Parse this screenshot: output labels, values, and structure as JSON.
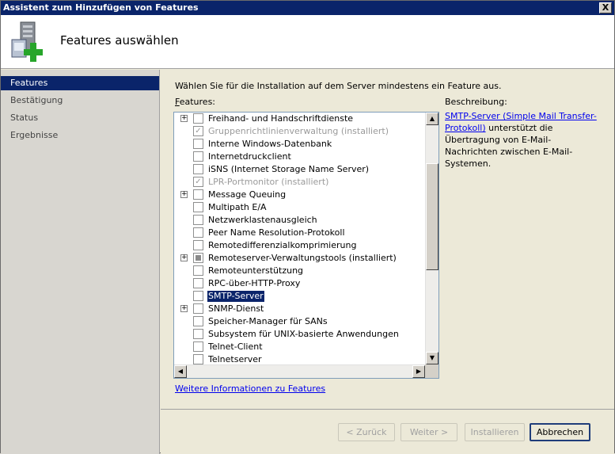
{
  "window": {
    "title": "Assistent zum Hinzufügen von Features",
    "close_label": "X"
  },
  "header": {
    "title": "Features auswählen",
    "icon": "server-add-icon"
  },
  "sidebar": {
    "items": [
      {
        "label": "Features",
        "active": true
      },
      {
        "label": "Bestätigung",
        "active": false
      },
      {
        "label": "Status",
        "active": false
      },
      {
        "label": "Ergebnisse",
        "active": false
      }
    ]
  },
  "main": {
    "intro": "Wählen Sie für die Installation auf dem Server mindestens ein Feature aus.",
    "features_label_prefix": "F",
    "features_label_rest": "eatures:",
    "description_label": "Beschreibung:",
    "description_link": "SMTP-Server (Simple Mail Transfer-Protokoll)",
    "description_text": " unterstützt die Übertragung von E-Mail-Nachrichten zwischen E-Mail-Systemen.",
    "more_info_link": "Weitere Informationen zu Features"
  },
  "features": [
    {
      "label": "Freihand- und Handschriftdienste",
      "expandable": true,
      "state": "unchecked",
      "dim": false,
      "selected": false
    },
    {
      "label": "Gruppenrichtlinienverwaltung (installiert)",
      "expandable": false,
      "state": "checked",
      "dim": true,
      "selected": false
    },
    {
      "label": "Interne Windows-Datenbank",
      "expandable": false,
      "state": "unchecked",
      "dim": false,
      "selected": false
    },
    {
      "label": "Internetdruckclient",
      "expandable": false,
      "state": "unchecked",
      "dim": false,
      "selected": false
    },
    {
      "label": "iSNS (Internet Storage Name Server)",
      "expandable": false,
      "state": "unchecked",
      "dim": false,
      "selected": false
    },
    {
      "label": "LPR-Portmonitor (installiert)",
      "expandable": false,
      "state": "checked",
      "dim": true,
      "selected": false
    },
    {
      "label": "Message Queuing",
      "expandable": true,
      "state": "unchecked",
      "dim": false,
      "selected": false
    },
    {
      "label": "Multipath E/A",
      "expandable": false,
      "state": "unchecked",
      "dim": false,
      "selected": false
    },
    {
      "label": "Netzwerklastenausgleich",
      "expandable": false,
      "state": "unchecked",
      "dim": false,
      "selected": false
    },
    {
      "label": "Peer Name Resolution-Protokoll",
      "expandable": false,
      "state": "unchecked",
      "dim": false,
      "selected": false
    },
    {
      "label": "Remotedifferenzialkomprimierung",
      "expandable": false,
      "state": "unchecked",
      "dim": false,
      "selected": false
    },
    {
      "label": "Remoteserver-Verwaltungstools (installiert)",
      "expandable": true,
      "state": "partial",
      "dim": false,
      "selected": false
    },
    {
      "label": "Remoteunterstützung",
      "expandable": false,
      "state": "unchecked",
      "dim": false,
      "selected": false
    },
    {
      "label": "RPC-über-HTTP-Proxy",
      "expandable": false,
      "state": "unchecked",
      "dim": false,
      "selected": false
    },
    {
      "label": "SMTP-Server",
      "expandable": false,
      "state": "unchecked",
      "dim": false,
      "selected": true
    },
    {
      "label": "SNMP-Dienst",
      "expandable": true,
      "state": "unchecked",
      "dim": false,
      "selected": false
    },
    {
      "label": "Speicher-Manager für SANs",
      "expandable": false,
      "state": "unchecked",
      "dim": false,
      "selected": false
    },
    {
      "label": "Subsystem für UNIX-basierte Anwendungen",
      "expandable": false,
      "state": "unchecked",
      "dim": false,
      "selected": false
    },
    {
      "label": "Telnet-Client",
      "expandable": false,
      "state": "unchecked",
      "dim": false,
      "selected": false
    },
    {
      "label": "Telnetserver",
      "expandable": false,
      "state": "unchecked",
      "dim": false,
      "selected": false
    }
  ],
  "buttons": {
    "back": "< Zurück",
    "next": "Weiter >",
    "install": "Installieren",
    "cancel": "Abbrechen"
  },
  "colors": {
    "selection": "#0a246a",
    "link": "#0000ee",
    "titlebar": "#0a246a"
  }
}
